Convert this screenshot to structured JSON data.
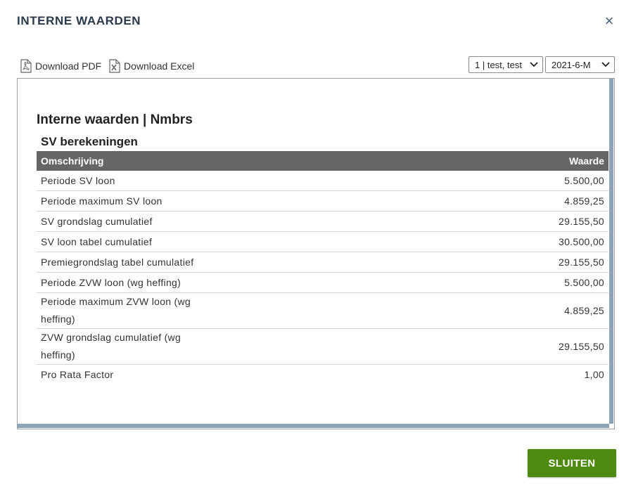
{
  "dialog": {
    "title": "INTERNE WAARDEN",
    "close_icon": "×"
  },
  "toolbar": {
    "download_pdf": "Download PDF",
    "download_excel": "Download Excel",
    "employee_select": "1 | test, test",
    "period_select": "2021-6-M"
  },
  "report": {
    "title": "Interne waarden | Nmbrs",
    "section": "SV berekeningen",
    "columns": [
      "Omschrijving",
      "Waarde"
    ],
    "rows": [
      {
        "desc": "Periode SV loon",
        "value": "5.500,00"
      },
      {
        "desc": "Periode maximum SV loon",
        "value": "4.859,25"
      },
      {
        "desc": "SV grondslag cumulatief",
        "value": "29.155,50"
      },
      {
        "desc": "SV loon tabel cumulatief",
        "value": "30.500,00"
      },
      {
        "desc": "Premiegrondslag tabel cumulatief",
        "value": "29.155,50"
      },
      {
        "desc": "Periode ZVW loon (wg heffing)",
        "value": "5.500,00"
      },
      {
        "desc": "Periode maximum ZVW loon (wg heffing)",
        "value": "4.859,25"
      },
      {
        "desc": "ZVW grondslag cumulatief (wg heffing)",
        "value": "29.155,50"
      },
      {
        "desc": "Pro Rata Factor",
        "value": "1,00"
      }
    ]
  },
  "footer": {
    "close_label": "SLUITEN"
  },
  "colors": {
    "primary_button": "#4e8a0f",
    "header_bg": "#666666",
    "scrollbar": "#8ea3b6"
  }
}
